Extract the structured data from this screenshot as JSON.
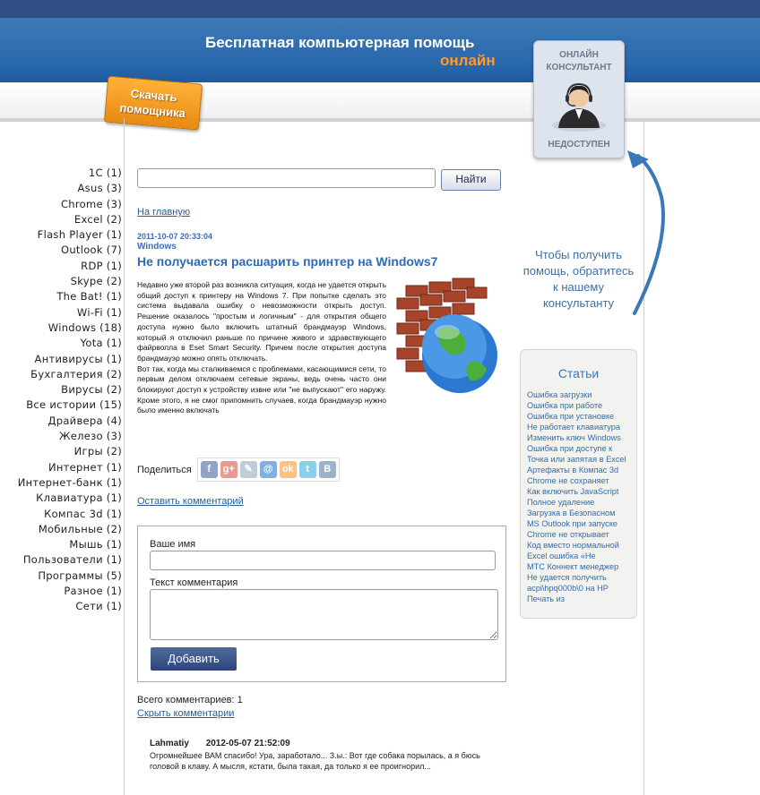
{
  "header": {
    "title": "Бесплатная компьютерная помощь",
    "title_accent": "онлайн",
    "download_button": "Скачать помощника"
  },
  "consultant": {
    "label": "ОНЛАЙН КОНСУЛЬТАНТ",
    "status": "НЕДОСТУПЕН"
  },
  "categories": [
    "1C (1)",
    "Asus (3)",
    "Chrome (3)",
    "Excel (2)",
    "Flash Player (1)",
    "Outlook (7)",
    "RDP (1)",
    "Skype (2)",
    "The Bat! (1)",
    "Wi-Fi (1)",
    "Windows (18)",
    "Yota (1)",
    "Антивирусы (1)",
    "Бухгалтерия (2)",
    "Вирусы (2)",
    "Все истории (15)",
    "Драйвера (4)",
    "Железо (3)",
    "Игры (2)",
    "Интернет (1)",
    "Интернет-банк (1)",
    "Клавиатура (1)",
    "Компас 3d (1)",
    "Мобильные (2)",
    "Мышь (1)",
    "Пользователи (1)",
    "Программы (5)",
    "Разное (1)",
    "Сети (1)"
  ],
  "search": {
    "value": "",
    "button": "Найти"
  },
  "nav": {
    "home_link": "На главную"
  },
  "post": {
    "date": "2011-10-07 20:33:04",
    "category": "Windows",
    "title": "Не получается расшарить принтер на Windows7",
    "body": "Недавно уже второй раз возникла ситуация, когда не удается открыть общий доступ к принтеру на Windows 7. При попытке сделать это система выдавала ошибку о невозможности открыть доступ. Решение оказалось \"простым и логичным\" - для открытия общего доступа нужно было включить штатный брандмауэр Windows, который я отключил раньше по причине живого и здравствующего файрволла в Eset Smart Security. Причем после открытия доступа брандмауэр можно опять отключать.",
    "body2": "Вот так, когда мы сталкиваемся с проблемами, касающимися сети, то первым делом отключаем сетевые экраны, ведь очень часто они блокируют доступ к устройству извне или \"не выпускают\" его наружу. Кроме этого, я не смог припомнить случаев, когда брандмауэр нужно было именно включать"
  },
  "share": {
    "label": "Поделиться",
    "icons": [
      "f",
      "g+",
      "✎",
      "@",
      "ok",
      "t",
      "B"
    ]
  },
  "comment_link": "Оставить комментарий",
  "comment_form": {
    "name_label": "Ваше имя",
    "name_value": "",
    "text_label": "Текст комментария",
    "text_value": "",
    "submit": "Добавить"
  },
  "comments_summary": {
    "total": "Всего комментариев: 1",
    "hide_link": "Скрыть комментарии"
  },
  "comment": {
    "author": "Lahmatiy",
    "date": "2012-05-07 21:52:09",
    "text": "Огромнейшее ВАМ спасибо! Ура, заработало... З.ы.: Вот где собака порылась, а я бюсь головой в клаву. А мысля, кстати, была такая, да только я ее проигнорил..."
  },
  "help_text": "Чтобы получить помощь, обратитесь к нашему консультанту",
  "articles": {
    "title": "Статьи",
    "items": [
      "Ошибка загрузки",
      "Ошибка при работе",
      "Ошибка при установке",
      "Не работает клавиатура",
      "Изменить ключ Windows",
      "Ошибка при доступе к",
      "Точка или запятая в Excel",
      "Артефакты в Компас 3d",
      "Chrome не сохраняет",
      "Как включить JavaScript",
      "Полное удаление",
      "Загрузка в Безопасном",
      "MS Outlook при запуске",
      "Chrome не открывает",
      "Код вместо нормальной",
      "Excel ошибка «Не",
      "МТС Коннект менеджер",
      "Не удается получить",
      "acpi\\hpq000b\\0 на HP",
      "Печать из"
    ]
  },
  "colors": {
    "header_blue": "#2a69ad",
    "accent_orange": "#ff9a2e",
    "link_blue": "#2a5c97",
    "title_blue": "#2d6bb5"
  }
}
